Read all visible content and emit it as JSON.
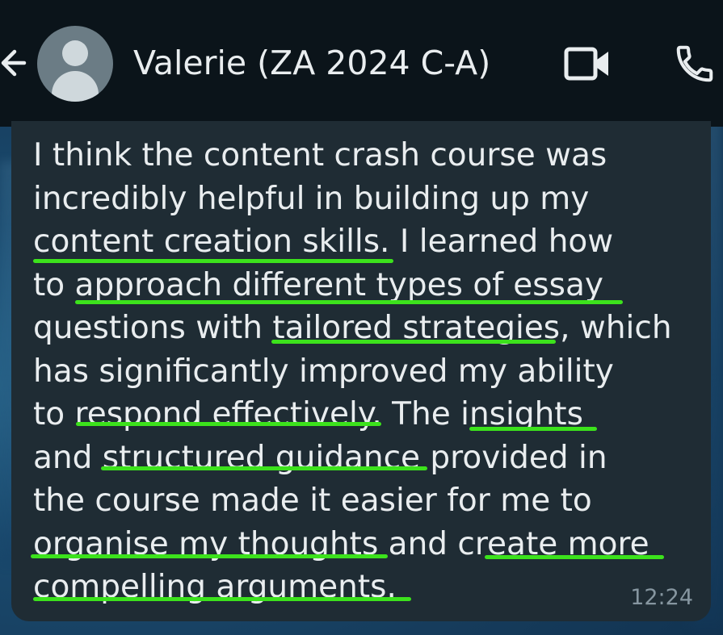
{
  "header": {
    "back_icon": "arrow-left-icon",
    "avatar_icon": "default-avatar-icon",
    "contact_name": "Valerie (ZA 2024 C-A)",
    "video_icon": "video-camera-icon",
    "call_icon": "phone-icon"
  },
  "message": {
    "lines": [
      "I think the content crash course was",
      "incredibly helpful in building up my",
      "content creation skills. I learned how",
      "to approach different types of essay",
      "questions with tailored strategies, which",
      "has significantly improved my ability",
      "to respond effectively. The insights",
      "and structured guidance provided in",
      "the course made it easier for me to",
      "organise my thoughts and create more",
      "compelling arguments."
    ],
    "time": "12:24",
    "highlighted_phrases": [
      "content creation skills",
      "approach different types of essay",
      "tailored strategies",
      "respond effectively",
      "insights",
      "structured guidance",
      "organise my thoughts",
      "create more",
      "compelling arguments."
    ],
    "highlight_color": "#3ce21c"
  },
  "colors": {
    "header_bg": "#0b141a",
    "bubble_bg": "#1f2c34",
    "text": "#e9edef",
    "time_text": "#8696a0"
  }
}
